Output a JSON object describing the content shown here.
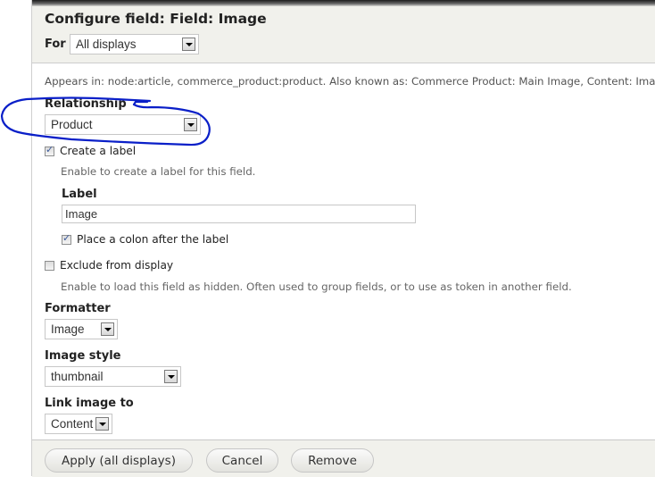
{
  "dialog": {
    "title": "Configure field: Field: Image",
    "for_label": "For",
    "for_select": {
      "value": "All displays"
    },
    "appears_in": "Appears in: node:article, commerce_product:product. Also known as: Commerce Product: Main Image, Content: Image"
  },
  "form": {
    "relationship": {
      "label": "Relationship",
      "value": "Product"
    },
    "create_label": {
      "label": "Create a label",
      "checked": true,
      "description": "Enable to create a label for this field."
    },
    "label_field": {
      "label": "Label",
      "value": "Image"
    },
    "place_colon": {
      "label": "Place a colon after the label",
      "checked": true
    },
    "exclude": {
      "label": "Exclude from display",
      "checked": false,
      "description": "Enable to load this field as hidden. Often used to group fields, or to use as token in another field."
    },
    "formatter": {
      "label": "Formatter",
      "value": "Image"
    },
    "image_style": {
      "label": "Image style",
      "value": "thumbnail"
    },
    "link_image_to": {
      "label": "Link image to",
      "value": "Content"
    }
  },
  "footer": {
    "apply_label": "Apply (all displays)",
    "cancel_label": "Cancel",
    "remove_label": "Remove"
  },
  "annotation": {
    "color": "#0a1fc8"
  }
}
